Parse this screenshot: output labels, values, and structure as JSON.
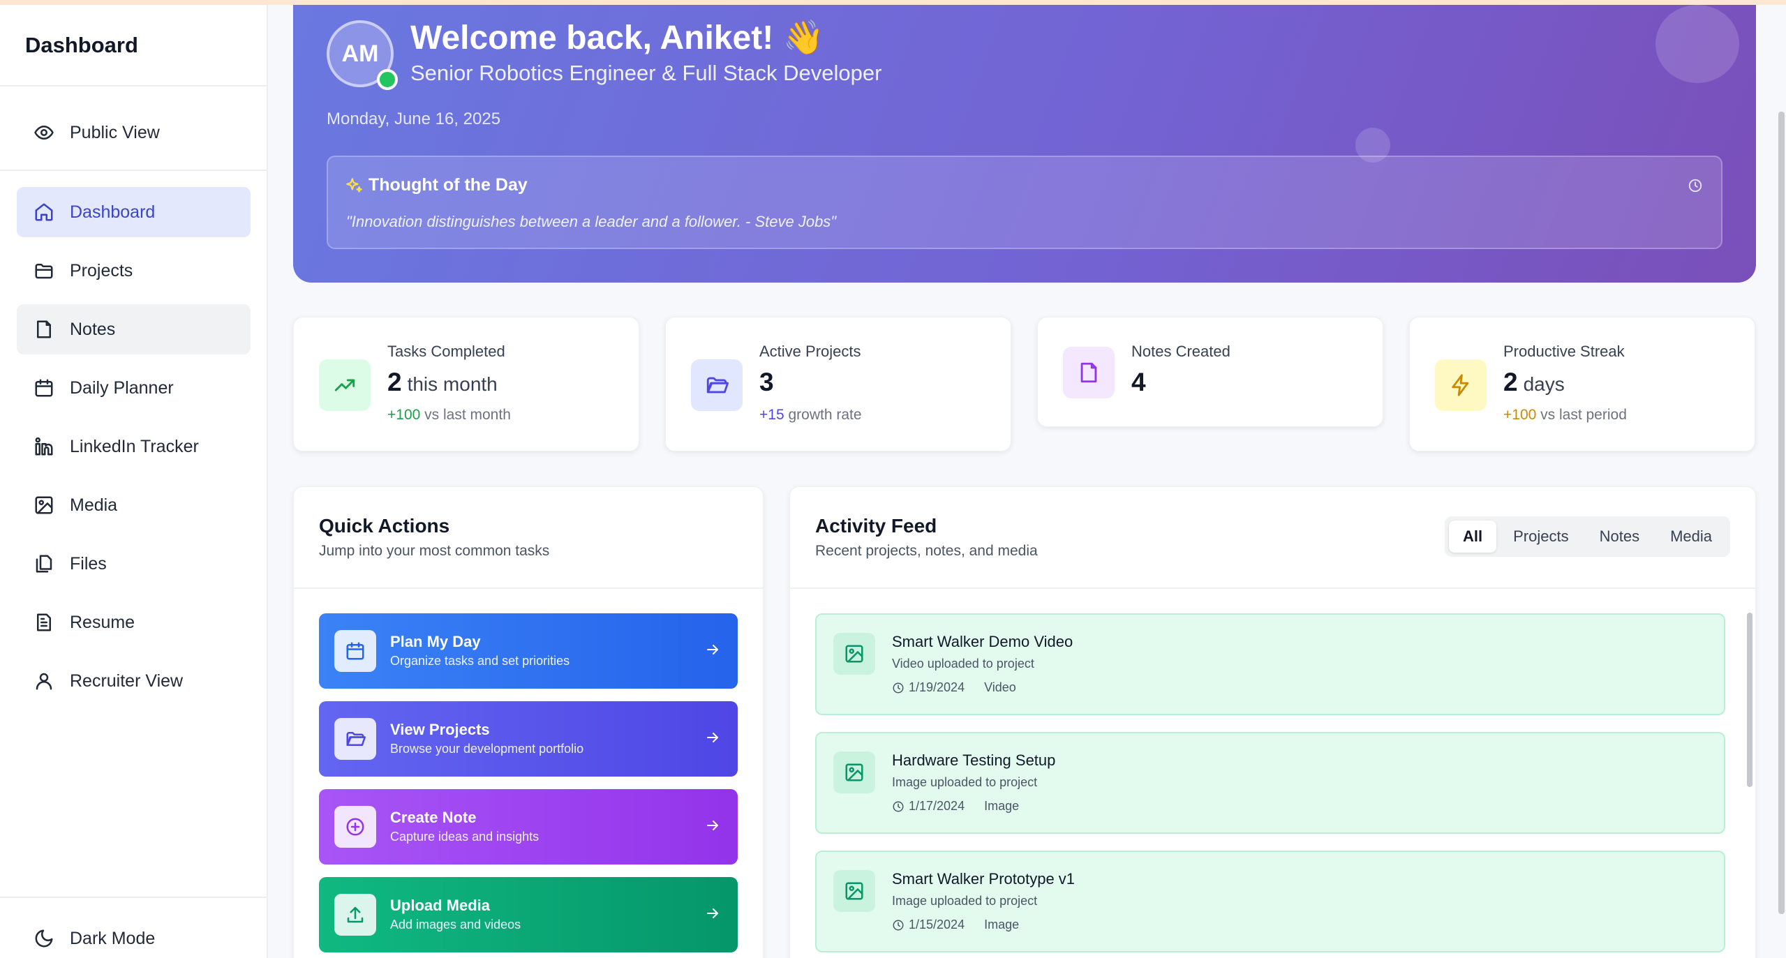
{
  "sidebar": {
    "title": "Dashboard",
    "public_view": "Public View",
    "items": [
      {
        "label": "Dashboard"
      },
      {
        "label": "Projects"
      },
      {
        "label": "Notes"
      },
      {
        "label": "Daily Planner"
      },
      {
        "label": "LinkedIn Tracker"
      },
      {
        "label": "Media"
      },
      {
        "label": "Files"
      },
      {
        "label": "Resume"
      },
      {
        "label": "Recruiter View"
      }
    ],
    "dark_mode": "Dark Mode"
  },
  "hero": {
    "initials": "AM",
    "welcome": "Welcome back, Aniket! 👋",
    "role": "Senior Robotics Engineer & Full Stack Developer",
    "date": "Monday, June 16, 2025",
    "thought_title": "Thought of the Day",
    "thought_quote": "\"Innovation distinguishes between a leader and a follower. - Steve Jobs\""
  },
  "stats": [
    {
      "label": "Tasks Completed",
      "value": "2",
      "unit": "this month",
      "delta": "+100",
      "delta_text": "vs last month",
      "delta_color": "#16a34a",
      "icon_bg": "#dcfce7",
      "icon_color": "#16a34a"
    },
    {
      "label": "Active Projects",
      "value": "3",
      "unit": "",
      "delta": "+15",
      "delta_text": "growth rate",
      "delta_color": "#4f46e5",
      "icon_bg": "#e0e7ff",
      "icon_color": "#4f46e5"
    },
    {
      "label": "Notes Created",
      "value": "4",
      "unit": "",
      "delta": "",
      "delta_text": "",
      "delta_color": "#9333ea",
      "icon_bg": "#f3e8ff",
      "icon_color": "#9333ea"
    },
    {
      "label": "Productive Streak",
      "value": "2",
      "unit": "days",
      "delta": "+100",
      "delta_text": "vs last period",
      "delta_color": "#ca8a04",
      "icon_bg": "#fef9c3",
      "icon_color": "#ca8a04"
    }
  ],
  "quick_actions": {
    "title": "Quick Actions",
    "subtitle": "Jump into your most common tasks",
    "items": [
      {
        "title": "Plan My Day",
        "subtitle": "Organize tasks and set priorities"
      },
      {
        "title": "View Projects",
        "subtitle": "Browse your development portfolio"
      },
      {
        "title": "Create Note",
        "subtitle": "Capture ideas and insights"
      },
      {
        "title": "Upload Media",
        "subtitle": "Add images and videos"
      }
    ]
  },
  "activity": {
    "title": "Activity Feed",
    "subtitle": "Recent projects, notes, and media",
    "tabs": [
      "All",
      "Projects",
      "Notes",
      "Media"
    ],
    "active_tab": "All",
    "items": [
      {
        "title": "Smart Walker Demo Video",
        "subtitle": "Video uploaded to project",
        "date": "1/19/2024",
        "type": "Video"
      },
      {
        "title": "Hardware Testing Setup",
        "subtitle": "Image uploaded to project",
        "date": "1/17/2024",
        "type": "Image"
      },
      {
        "title": "Smart Walker Prototype v1",
        "subtitle": "Image uploaded to project",
        "date": "1/15/2024",
        "type": "Image"
      }
    ]
  }
}
